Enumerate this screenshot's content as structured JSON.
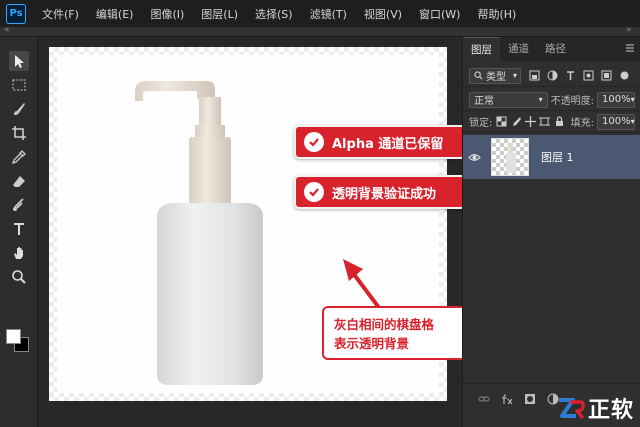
{
  "app": {
    "logo_text": "Ps"
  },
  "menu": {
    "items": [
      "文件(F)",
      "编辑(E)",
      "图像(I)",
      "图层(L)",
      "选择(S)",
      "滤镜(T)",
      "视图(V)",
      "窗口(W)",
      "帮助(H)"
    ]
  },
  "canvas": {
    "callouts": [
      {
        "text": "Alpha 通道已保留"
      },
      {
        "text": "透明背景验证成功"
      }
    ],
    "note": {
      "line1": "灰白相间的棋盘格",
      "line2": "表示透明背景"
    },
    "colors": {
      "callout_red": "#d8222c",
      "checker_gray": "#ececec"
    }
  },
  "tools": {
    "icons": [
      "move-icon",
      "marquee-icon",
      "brush-icon",
      "crop-icon",
      "eyedropper-icon",
      "eraser-icon",
      "healing-icon",
      "text-icon",
      "hand-icon",
      "zoom-icon"
    ],
    "foreground_color": "#ffffff",
    "background_color": "#000000"
  },
  "panel": {
    "tabs": [
      "图层",
      "通道",
      "路径"
    ],
    "active_tab": "图层",
    "filter": {
      "label": "类型",
      "icon": "search-icon"
    },
    "blend_mode": "正常",
    "opacity_label": "不透明度:",
    "opacity_value": "100%",
    "lock_label": "锁定:",
    "fill_label": "填充:",
    "fill_value": "100%",
    "layers": [
      {
        "name": "图层 1"
      }
    ],
    "bottom_icons": [
      "link-icon",
      "fx-icon",
      "mask-icon",
      "adjustment-icon",
      "group-icon",
      "new-layer-icon",
      "delete-icon"
    ]
  },
  "watermark": {
    "text": "正软"
  }
}
